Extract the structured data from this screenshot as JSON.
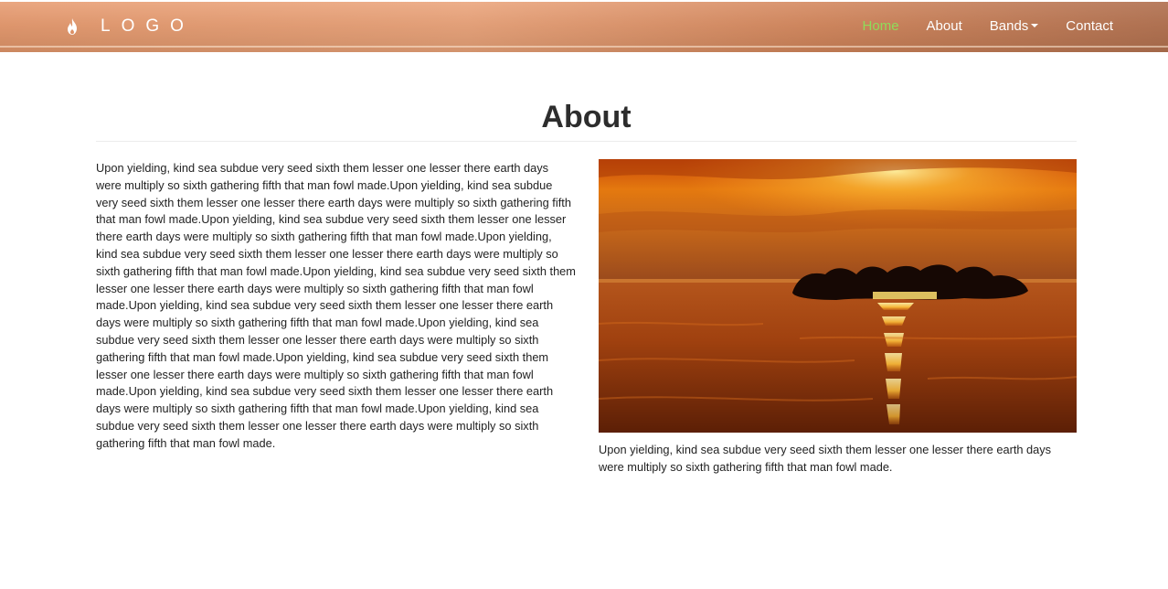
{
  "brand": {
    "logo_text": "LOGO",
    "icon": "flame-icon"
  },
  "nav": {
    "items": [
      {
        "label": "Home",
        "active": true
      },
      {
        "label": "About",
        "active": false
      },
      {
        "label": "Bands",
        "active": false,
        "has_dropdown": true
      },
      {
        "label": "Contact",
        "active": false
      }
    ]
  },
  "colors": {
    "nav_active": "#8fdc5a",
    "nav_text": "#ffffff",
    "navbar_bg": "#dc9065"
  },
  "page": {
    "title": "About",
    "body": "Upon yielding, kind sea subdue very seed sixth them lesser one lesser there earth days were multiply so sixth gathering fifth that man fowl made.Upon yielding, kind sea subdue very seed sixth them lesser one lesser there earth days were multiply so sixth gathering fifth that man fowl made.Upon yielding, kind sea subdue very seed sixth them lesser one lesser there earth days were multiply so sixth gathering fifth that man fowl made.Upon yielding, kind sea subdue very seed sixth them lesser one lesser there earth days were multiply so sixth gathering fifth that man fowl made.Upon yielding, kind sea subdue very seed sixth them lesser one lesser there earth days were multiply so sixth gathering fifth that man fowl made.Upon yielding, kind sea subdue very seed sixth them lesser one lesser there earth days were multiply so sixth gathering fifth that man fowl made.Upon yielding, kind sea subdue very seed sixth them lesser one lesser there earth days were multiply so sixth gathering fifth that man fowl made.Upon yielding, kind sea subdue very seed sixth them lesser one lesser there earth days were multiply so sixth gathering fifth that man fowl made.Upon yielding, kind sea subdue very seed sixth them lesser one lesser there earth days were multiply so sixth gathering fifth that man fowl made.Upon yielding, kind sea subdue very seed sixth them lesser one lesser there earth days were multiply so sixth gathering fifth that man fowl made.",
    "image_caption": "Upon yielding, kind sea subdue very seed sixth them lesser one lesser there earth days were multiply so sixth gathering fifth that man fowl made."
  }
}
